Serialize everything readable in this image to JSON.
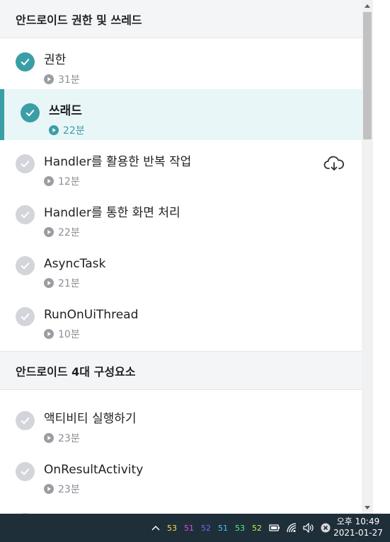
{
  "sections": [
    {
      "title": "안드로이드 권한 및 쓰레드",
      "lessons": [
        {
          "title": "권한",
          "duration": "31분",
          "completed": true,
          "active": false
        },
        {
          "title": "쓰래드",
          "duration": "22분",
          "completed": true,
          "active": true
        },
        {
          "title": "Handler를 활용한 반복 작업",
          "duration": "12분",
          "completed": false,
          "active": false,
          "download_icon": "cloud-download-icon"
        },
        {
          "title": "Handler를 통한 화면 처리",
          "duration": "22분",
          "completed": false,
          "active": false
        },
        {
          "title": "AsyncTask",
          "duration": "21분",
          "completed": false,
          "active": false
        },
        {
          "title": "RunOnUiThread",
          "duration": "10분",
          "completed": false,
          "active": false
        }
      ]
    },
    {
      "title": "안드로이드 4대 구성요소",
      "lessons": [
        {
          "title": "액티비티 실행하기",
          "duration": "23분",
          "completed": false,
          "active": false
        },
        {
          "title": "OnResultActivity",
          "duration": "23분",
          "completed": false,
          "active": false
        }
      ]
    }
  ],
  "taskbar": {
    "tray_numbers": [
      {
        "value": "53",
        "color": "#f2e24a"
      },
      {
        "value": "51",
        "color": "#e04ae0"
      },
      {
        "value": "52",
        "color": "#6a6af2"
      },
      {
        "value": "51",
        "color": "#4ac8f2"
      },
      {
        "value": "53",
        "color": "#4af27a"
      },
      {
        "value": "52",
        "color": "#b6f24a"
      }
    ],
    "clock_time": "오후 10:49",
    "clock_date": "2021-01-27"
  },
  "colors": {
    "accent": "#3a9ea6",
    "inactive_check": "#d3d5da",
    "active_bg": "#e9f6f8",
    "taskbar_bg": "#1f2f3a"
  }
}
